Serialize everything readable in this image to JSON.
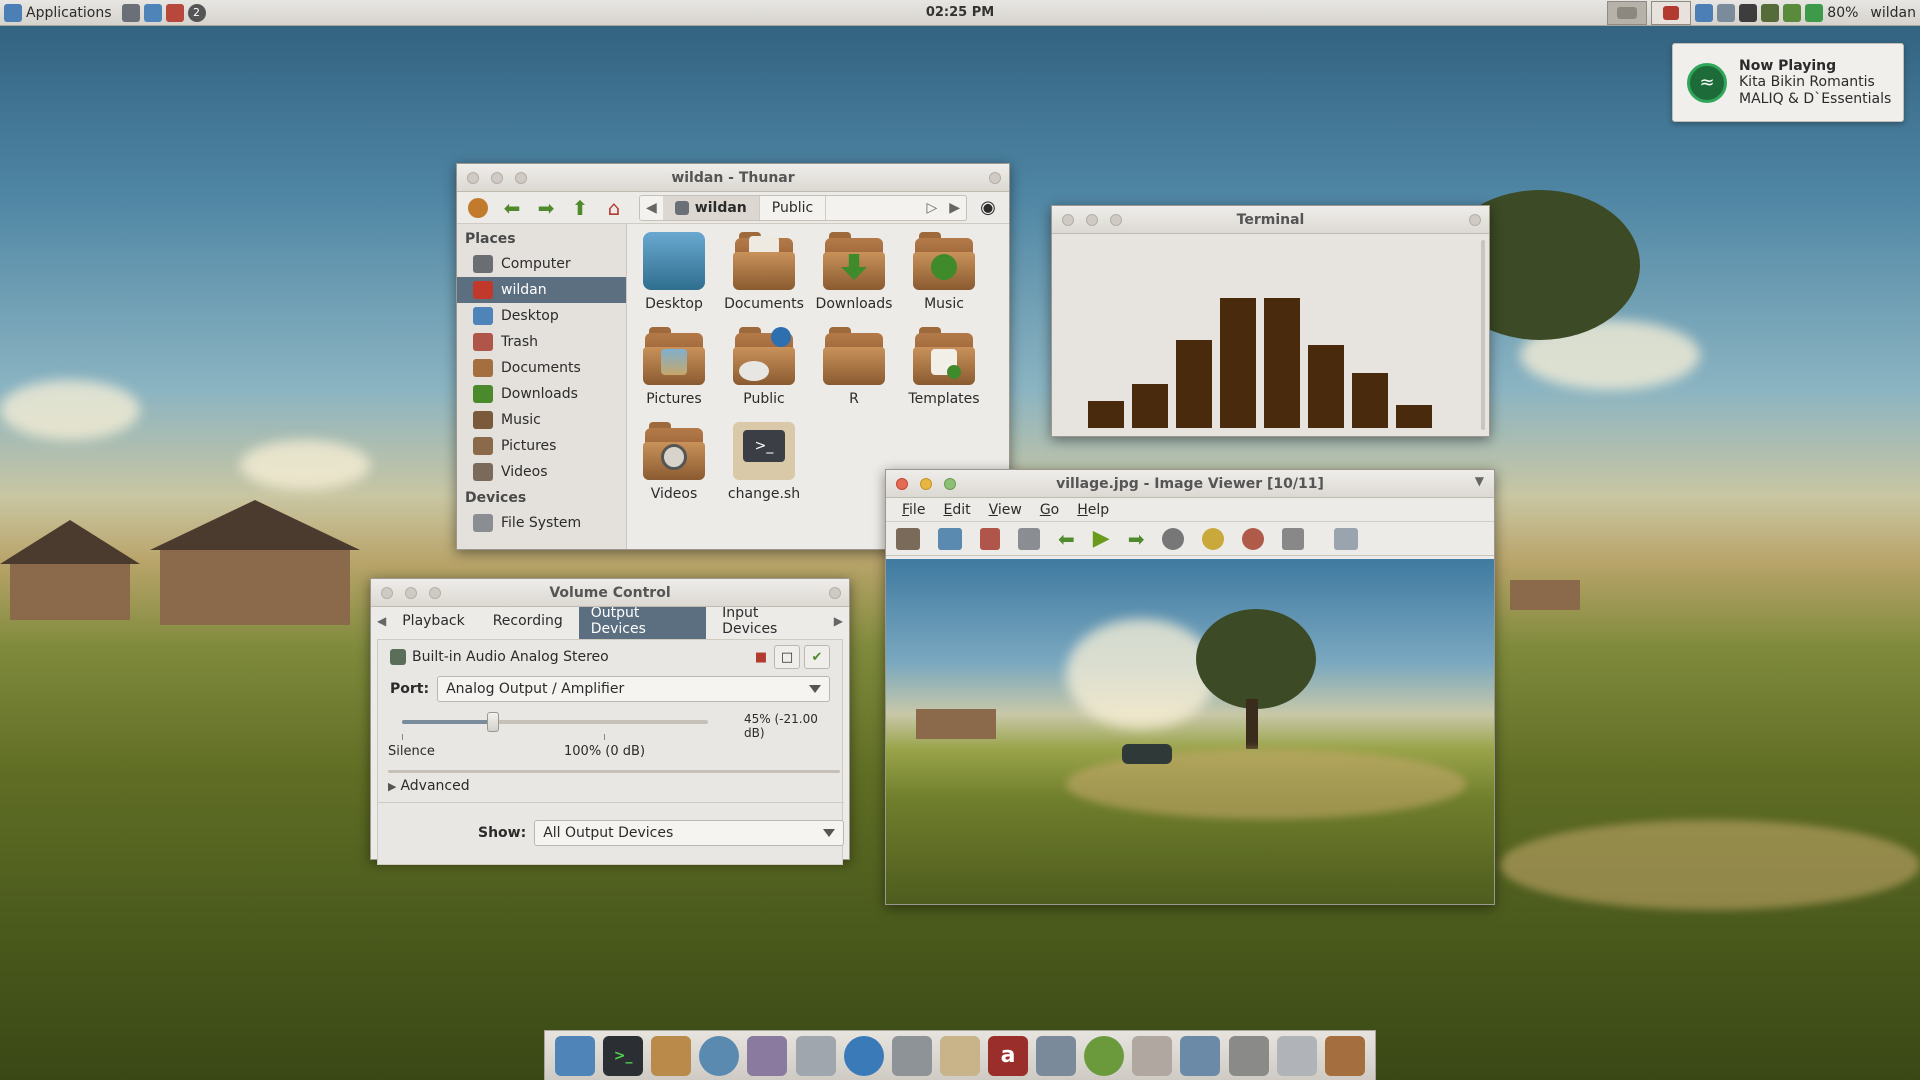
{
  "panel": {
    "apps_label": "Applications",
    "clock": "02:25 PM",
    "battery": "80%",
    "user": "wildan",
    "launchers": [
      "thunar-icon",
      "image-viewer-icon",
      "volume-icon",
      "workspace-badge"
    ],
    "badge": "2"
  },
  "notification": {
    "title": "Now Playing",
    "song": "Kita Bikin Romantis",
    "artist": "MALIQ & D`Essentials"
  },
  "thunar": {
    "title": "wildan - Thunar",
    "crumbs": [
      "wildan",
      "Public"
    ],
    "places_header": "Places",
    "places": [
      "Computer",
      "wildan",
      "Desktop",
      "Trash",
      "Documents",
      "Downloads",
      "Music",
      "Pictures",
      "Videos"
    ],
    "devices_header": "Devices",
    "devices": [
      "File System"
    ],
    "files": [
      "Desktop",
      "Documents",
      "Downloads",
      "Music",
      "Pictures",
      "Public",
      "R",
      "Templates",
      "Videos",
      "change.sh"
    ]
  },
  "terminal": {
    "title": "Terminal",
    "bars": [
      0.2,
      0.33,
      0.66,
      0.97,
      0.97,
      0.62,
      0.41,
      0.17
    ],
    "bar_color": "#4a2a0c"
  },
  "viewer": {
    "title": "village.jpg - Image Viewer [10/11]",
    "menu": [
      "File",
      "Edit",
      "View",
      "Go",
      "Help"
    ]
  },
  "volume": {
    "title": "Volume Control",
    "tabs": [
      "Playback",
      "Recording",
      "Output Devices",
      "Input Devices"
    ],
    "active_tab": "Output Devices",
    "device": "Built-in Audio Analog Stereo",
    "port_label": "Port:",
    "port_value": "Analog Output / Amplifier",
    "level_text": "45% (-21.00 dB)",
    "level": 0.45,
    "mark_silence": "Silence",
    "mark_full": "100% (0 dB)",
    "advanced": "Advanced",
    "show_label": "Show:",
    "show_value": "All Output Devices"
  },
  "dock": {
    "items": [
      "file-manager-icon",
      "terminal-icon",
      "archive-icon",
      "browser-icon",
      "text-editor-icon",
      "image-editor-icon",
      "mail-icon",
      "printer-icon",
      "notes-icon",
      "dictionary-icon",
      "settings-icon",
      "media-player-icon",
      "disk-utility-icon",
      "display-icon",
      "screenshot-icon",
      "tools-icon",
      "home-folder-icon"
    ]
  },
  "colors": {
    "accent": "#5c6f80",
    "folder": "#a56e3e"
  }
}
